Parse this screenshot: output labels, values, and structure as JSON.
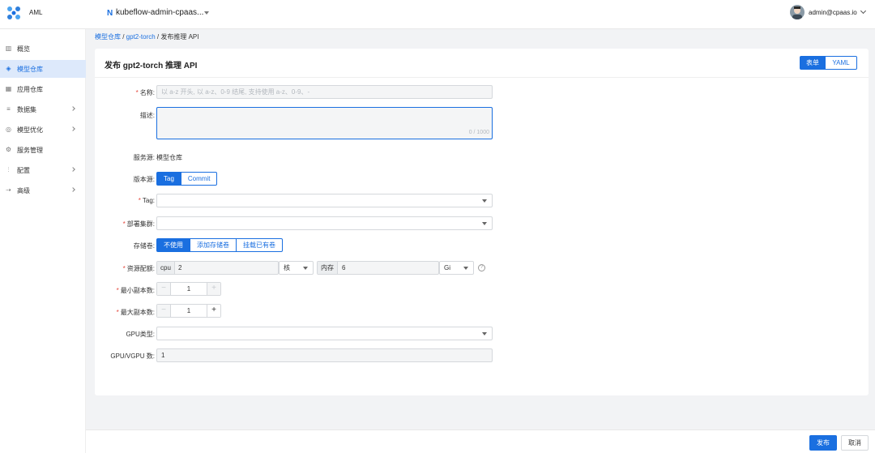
{
  "header": {
    "app_name": "AML",
    "namespace": "kubeflow-admin-cpaas...",
    "user": "admin@cpaas.io"
  },
  "sidebar": {
    "items": [
      {
        "label": "概览",
        "icon": "chart-icon"
      },
      {
        "label": "模型仓库",
        "icon": "cube-icon",
        "active": true
      },
      {
        "label": "应用仓库",
        "icon": "grid-icon"
      },
      {
        "label": "数据集",
        "icon": "database-icon",
        "expandable": true
      },
      {
        "label": "模型优化",
        "icon": "optimize-icon",
        "expandable": true
      },
      {
        "label": "服务管理",
        "icon": "service-icon"
      },
      {
        "label": "配置",
        "icon": "config-icon",
        "expandable": true
      },
      {
        "label": "高级",
        "icon": "advanced-icon",
        "expandable": true
      }
    ]
  },
  "breadcrumb": {
    "root": "模型仓库",
    "sep": " / ",
    "model": "gpt2-torch",
    "current": "发布推理 API"
  },
  "page": {
    "title": "发布 gpt2-torch 推理 API",
    "mode_form": "表单",
    "mode_yaml": "YAML"
  },
  "form": {
    "name_label": "名称:",
    "name_placeholder": "以 a-z 开头, 以 a-z、0-9 结尾, 支持使用 a-z、0-9、-",
    "desc_label": "描述:",
    "desc_counter": "0 / 1000",
    "source_label": "服务源:",
    "source_value": "模型仓库",
    "version_label": "版本源:",
    "version_options": [
      "Tag",
      "Commit"
    ],
    "tag_label": "Tag:",
    "cluster_label": "部署集群:",
    "storage_label": "存储卷:",
    "storage_options": [
      "不使用",
      "添加存储卷",
      "挂载已有卷"
    ],
    "resource_label": "资源配额:",
    "cpu_addon": "cpu",
    "cpu_value": "2",
    "cpu_unit": "核",
    "mem_addon": "内存",
    "mem_value": "6",
    "mem_unit": "Gi",
    "min_replicas_label": "最小副本数:",
    "min_replicas": "1",
    "max_replicas_label": "最大副本数:",
    "max_replicas": "1",
    "gpu_type_label": "GPU类型:",
    "gpu_count_label": "GPU/VGPU 数:",
    "gpu_count": "1",
    "help": "?",
    "minus": "−",
    "plus": "+"
  },
  "footer": {
    "submit": "发布",
    "cancel": "取消"
  },
  "colors": {
    "primary": "#1a6fe0",
    "required": "#e5483e",
    "active_nav_bg": "#dde9fb"
  }
}
